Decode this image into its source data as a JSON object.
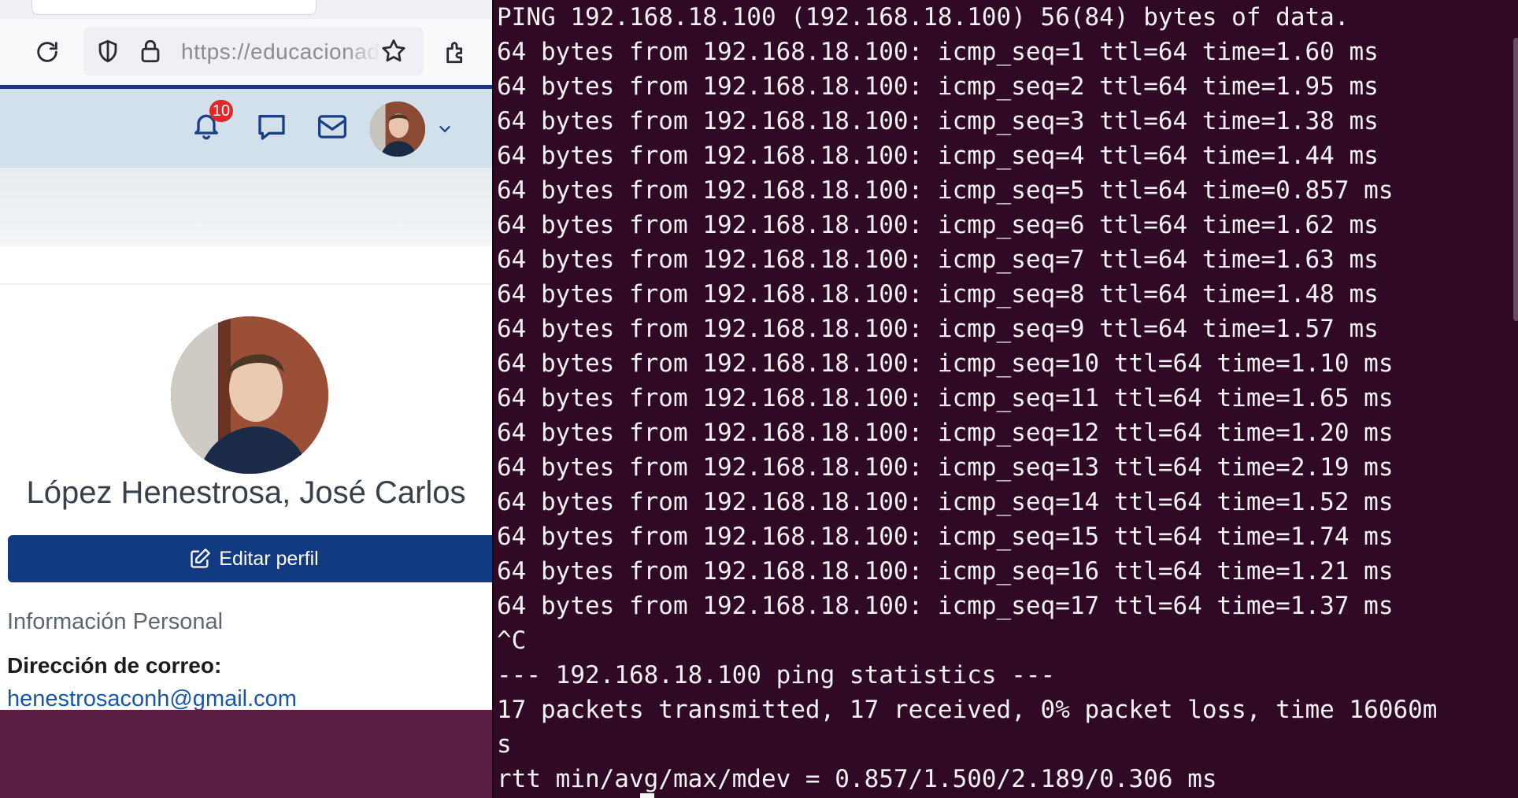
{
  "browser": {
    "url": "https://educacionadistancia.juntadeandalucia.es",
    "icons": {
      "reload": "reload-icon",
      "shield": "shield-icon",
      "lock": "lock-icon",
      "bookmark": "star-icon",
      "extensions": "extensions-icon"
    }
  },
  "site": {
    "notification_count": "10",
    "icons": [
      "bell-icon",
      "chat-icon",
      "mail-icon",
      "chevron-down-icon"
    ]
  },
  "profile": {
    "name": "López Henestrosa, José Carlos",
    "edit_button_label": "Editar perfil",
    "section_heading": "Información Personal",
    "email_label": "Dirección de correo:",
    "email_value": "henestrosaconh@gmail.com"
  },
  "terminal": {
    "lines": [
      "PING 192.168.18.100 (192.168.18.100) 56(84) bytes of data.",
      "64 bytes from 192.168.18.100: icmp_seq=1 ttl=64 time=1.60 ms",
      "64 bytes from 192.168.18.100: icmp_seq=2 ttl=64 time=1.95 ms",
      "64 bytes from 192.168.18.100: icmp_seq=3 ttl=64 time=1.38 ms",
      "64 bytes from 192.168.18.100: icmp_seq=4 ttl=64 time=1.44 ms",
      "64 bytes from 192.168.18.100: icmp_seq=5 ttl=64 time=0.857 ms",
      "64 bytes from 192.168.18.100: icmp_seq=6 ttl=64 time=1.62 ms",
      "64 bytes from 192.168.18.100: icmp_seq=7 ttl=64 time=1.63 ms",
      "64 bytes from 192.168.18.100: icmp_seq=8 ttl=64 time=1.48 ms",
      "64 bytes from 192.168.18.100: icmp_seq=9 ttl=64 time=1.57 ms",
      "64 bytes from 192.168.18.100: icmp_seq=10 ttl=64 time=1.10 ms",
      "64 bytes from 192.168.18.100: icmp_seq=11 ttl=64 time=1.65 ms",
      "64 bytes from 192.168.18.100: icmp_seq=12 ttl=64 time=1.20 ms",
      "64 bytes from 192.168.18.100: icmp_seq=13 ttl=64 time=2.19 ms",
      "64 bytes from 192.168.18.100: icmp_seq=14 ttl=64 time=1.52 ms",
      "64 bytes from 192.168.18.100: icmp_seq=15 ttl=64 time=1.74 ms",
      "64 bytes from 192.168.18.100: icmp_seq=16 ttl=64 time=1.21 ms",
      "64 bytes from 192.168.18.100: icmp_seq=17 ttl=64 time=1.37 ms",
      "^C",
      "--- 192.168.18.100 ping statistics ---",
      "17 packets transmitted, 17 received, 0% packet loss, time 16060m",
      "s",
      "rtt min/avg/max/mdev = 0.857/1.500/2.189/0.306 ms"
    ]
  },
  "colors": {
    "terminal_bg": "#300a24",
    "terminal_fg": "#f2f2f2",
    "site_primary": "#123a80",
    "badge": "#e3262a",
    "desktop_bg": "#5a1e43"
  }
}
